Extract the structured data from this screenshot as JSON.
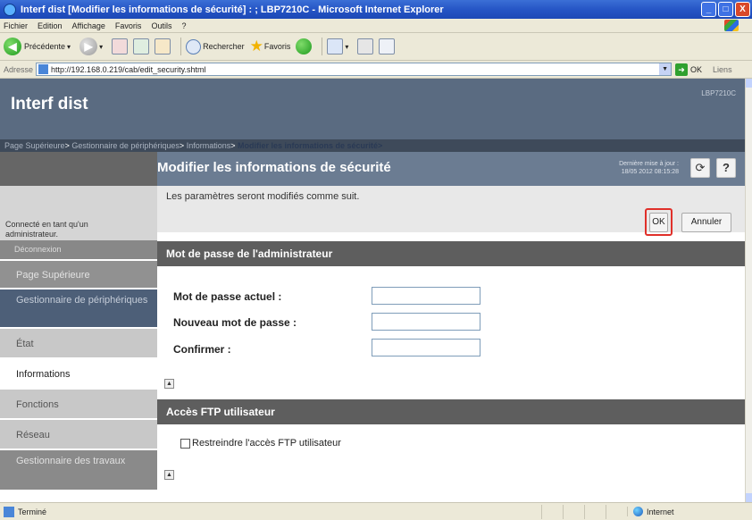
{
  "window": {
    "title": "Interf dist [Modifier les informations de sécurité] : ; LBP7210C - Microsoft Internet Explorer",
    "buttons": [
      "_",
      "□",
      "X"
    ]
  },
  "menu": [
    "Fichier",
    "Edition",
    "Affichage",
    "Favoris",
    "Outils",
    "?"
  ],
  "toolbar": {
    "back_label": "Précédente",
    "search_label": "Rechercher",
    "favorites_label": "Favoris"
  },
  "address": {
    "label": "Adresse",
    "url": "http://192.168.0.219/cab/edit_security.shtml",
    "go_label": "OK",
    "links_label": "Liens"
  },
  "site": {
    "title": "Interf dist",
    "model": "LBP7210C"
  },
  "breadcrumb": {
    "items": [
      "Page Supérieure",
      "Gestionnaire de périphériques",
      "Informations"
    ],
    "separator": ">",
    "current": "Modifier les informations de sécurité>"
  },
  "sidebar": {
    "user_status": "Connecté en tant qu'un administrateur.",
    "logout_label": "Déconnexion",
    "items": [
      {
        "label": "Page Supérieure"
      },
      {
        "label": "Gestionnaire de périphériques"
      },
      {
        "label": "État"
      },
      {
        "label": "Informations"
      },
      {
        "label": "Fonctions"
      },
      {
        "label": "Réseau"
      },
      {
        "label": "Gestionnaire des travaux"
      }
    ]
  },
  "page": {
    "title": "Modifier les informations de sécurité",
    "last_update_label": "Dernière mise à jour :",
    "last_update_value": "18/05 2012 08:15:28",
    "refresh_glyph": "⟳",
    "help_glyph": "?"
  },
  "form": {
    "notice": "Les paramètres seront modifiés comme suit.",
    "ok_label": "OK",
    "cancel_label": "Annuler",
    "admin_section": {
      "title": "Mot de passe de l'administrateur",
      "fields": [
        {
          "label": "Mot de passe actuel :",
          "value": ""
        },
        {
          "label": "Nouveau mot de passe :",
          "value": ""
        },
        {
          "label": "Confirmer :",
          "value": ""
        }
      ]
    },
    "ftp_section": {
      "title": "Accès FTP utilisateur",
      "checkbox_label": "Restreindre l'accès FTP utilisateur",
      "checked": false
    }
  },
  "status": {
    "text": "Terminé",
    "zone": "Internet"
  }
}
